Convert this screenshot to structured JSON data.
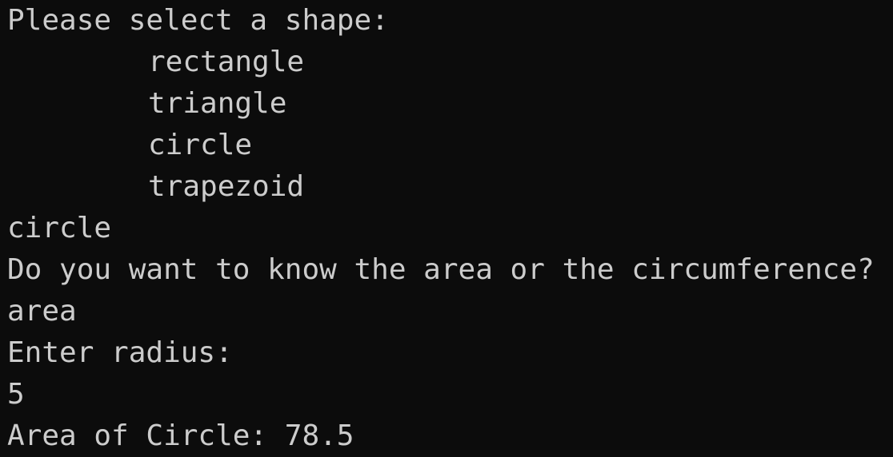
{
  "terminal": {
    "lines": [
      {
        "text": "Please select a shape:",
        "type": "prompt"
      },
      {
        "text": "rectangle",
        "type": "option"
      },
      {
        "text": "triangle",
        "type": "option"
      },
      {
        "text": "circle",
        "type": "option"
      },
      {
        "text": "trapezoid",
        "type": "option"
      },
      {
        "text": "circle",
        "type": "input"
      },
      {
        "text": "Do you want to know the area or the circumference?",
        "type": "prompt"
      },
      {
        "text": "area",
        "type": "input"
      },
      {
        "text": "Enter radius:",
        "type": "prompt"
      },
      {
        "text": "5",
        "type": "input"
      },
      {
        "text": "Area of Circle: 78.5",
        "type": "output"
      }
    ]
  },
  "colors": {
    "background": "#0c0c0c",
    "foreground": "#cccccc"
  }
}
